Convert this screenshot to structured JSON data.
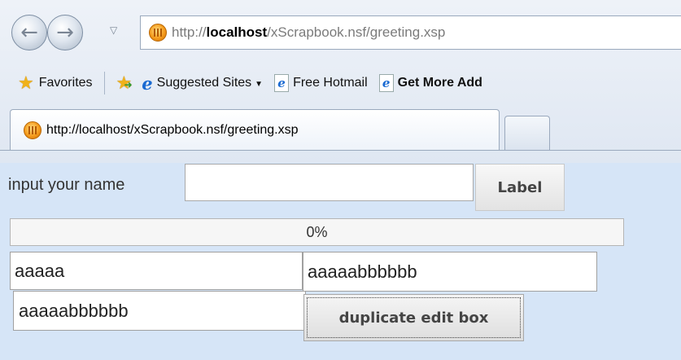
{
  "browser": {
    "address_bar": {
      "url_prefix": "http://",
      "url_host": "localhost",
      "url_path": "/xScrapbook.nsf/greeting.xsp"
    },
    "favorites_bar": {
      "favorites_label": "Favorites",
      "items": [
        {
          "label": "Suggested Sites",
          "icon": "ie-icon",
          "has_dropdown": true
        },
        {
          "label": "Free Hotmail",
          "icon": "ie-doc-icon"
        },
        {
          "label": "Get More Add",
          "icon": "ie-doc-icon"
        }
      ]
    },
    "tab": {
      "title": "http://localhost/xScrapbook.nsf/greeting.xsp"
    }
  },
  "form": {
    "name_label": "input your name",
    "name_value": "",
    "label_button": "Label",
    "progress": {
      "value": 0,
      "text": "0%"
    },
    "edit_box_1": "aaaaa",
    "edit_box_2": "aaaaabbbbbb",
    "edit_box_3": "aaaaabbbbbb",
    "duplicate_button": "duplicate edit box"
  },
  "colors": {
    "page_background": "#d6e5f7",
    "link_icon_blue": "#1a6ad2",
    "favorites_star": "#f0b21a"
  }
}
